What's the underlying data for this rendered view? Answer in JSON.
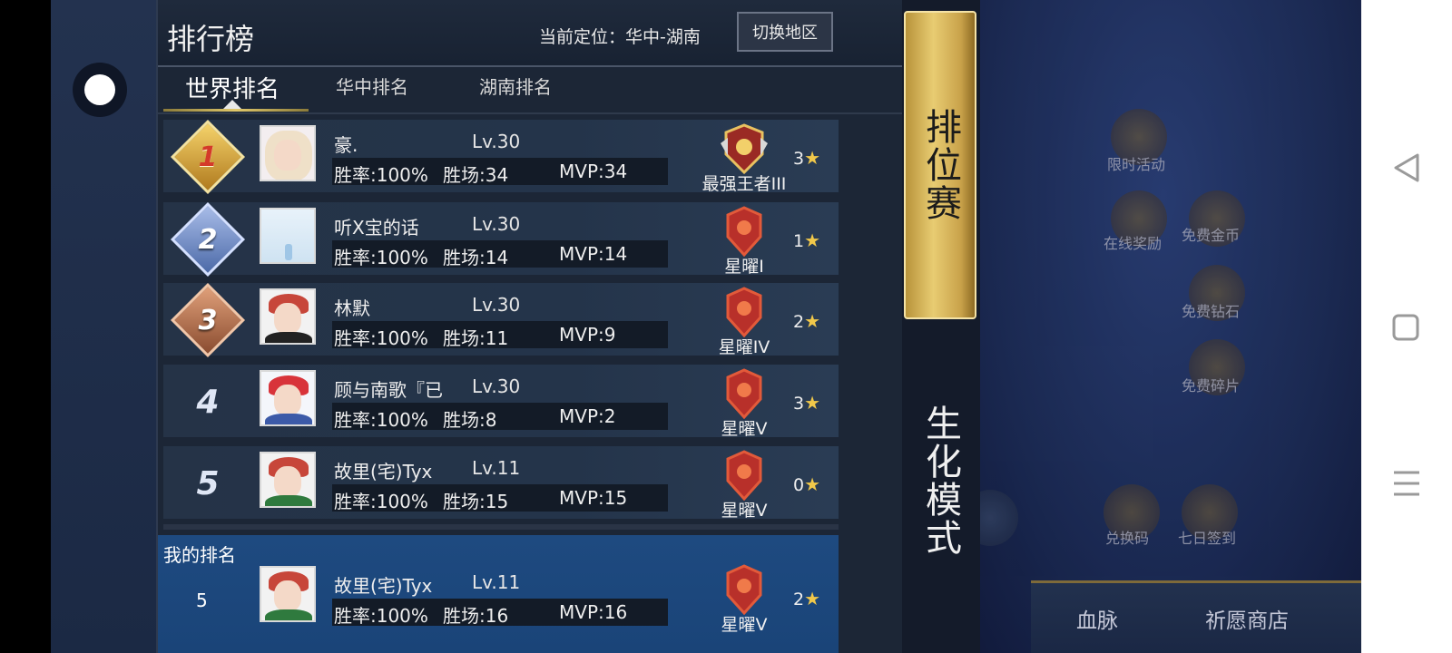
{
  "panel": {
    "title": "排行榜",
    "location": "当前定位：华中-湖南",
    "switch_button": "切换地区"
  },
  "tabs": [
    {
      "label": "世界排名",
      "active": true
    },
    {
      "label": "华中排名",
      "active": false
    },
    {
      "label": "湖南排名",
      "active": false
    }
  ],
  "rows": [
    {
      "rank": "1",
      "name": "豪.",
      "level": "Lv.30",
      "winrate": "胜率:100%",
      "wins": "胜场:34",
      "mvp": "MVP:34",
      "tier": "最强王者III",
      "stars": "3"
    },
    {
      "rank": "2",
      "name": "听X宝的话",
      "level": "Lv.30",
      "winrate": "胜率:100%",
      "wins": "胜场:14",
      "mvp": "MVP:14",
      "tier": "星曜I",
      "stars": "1"
    },
    {
      "rank": "3",
      "name": "林默",
      "level": "Lv.30",
      "winrate": "胜率:100%",
      "wins": "胜场:11",
      "mvp": "MVP:9",
      "tier": "星曜IV",
      "stars": "2"
    },
    {
      "rank": "4",
      "name": "顾与南歌『已",
      "level": "Lv.30",
      "winrate": "胜率:100%",
      "wins": "胜场:8",
      "mvp": "MVP:2",
      "tier": "星曜V",
      "stars": "3"
    },
    {
      "rank": "5",
      "name": "故里(宅)Tyx",
      "level": "Lv.11",
      "winrate": "胜率:100%",
      "wins": "胜场:15",
      "mvp": "MVP:15",
      "tier": "星曜V",
      "stars": "0"
    }
  ],
  "my_rank": {
    "label": "我的排名",
    "rank": "5",
    "name": "故里(宅)Tyx",
    "level": "Lv.11",
    "winrate": "胜率:100%",
    "wins": "胜场:16",
    "mvp": "MVP:16",
    "tier": "星曜V",
    "stars": "2"
  },
  "modes": [
    {
      "label": "排位赛",
      "active": true
    },
    {
      "label": "生化模式",
      "active": false
    }
  ],
  "background_menu": {
    "items": [
      "限时活动",
      "在线奖励",
      "免费金币",
      "免费钻石",
      "免费碎片",
      "兑换码",
      "七日签到"
    ],
    "bottom": [
      "血脉",
      "祈愿商店"
    ]
  },
  "icons": {
    "back": "chevron-left-icon",
    "star": "star-icon",
    "nav_back": "triangle-back-icon",
    "nav_home": "square-home-icon",
    "nav_menu": "hamburger-icon"
  },
  "colors": {
    "gold_accent": "#e0c76a",
    "my_rank_bg": "#1e4a80",
    "star": "#f1c84a"
  }
}
